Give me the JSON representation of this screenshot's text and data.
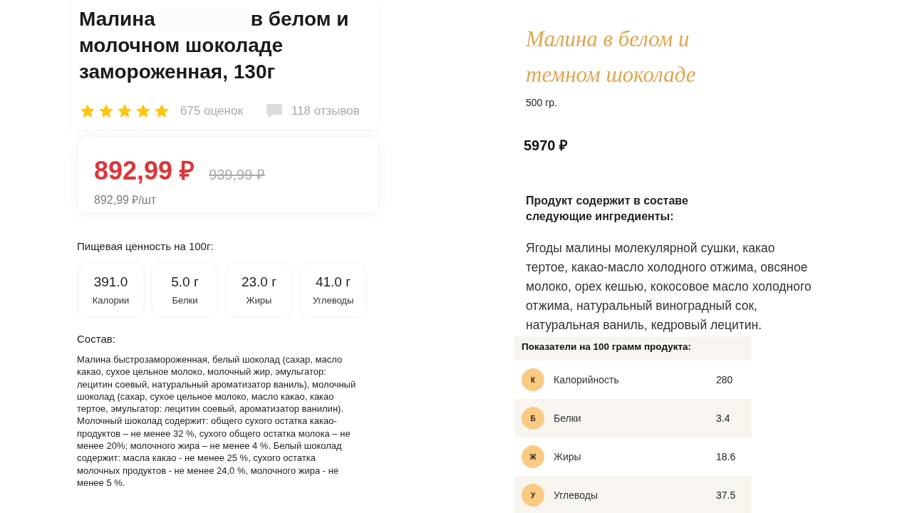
{
  "left": {
    "title_start": "Малина",
    "title_end": "в белом и молочном шоколаде замороженная, 130г",
    "rating": {
      "stars": 5,
      "ratings_count": "675 оценок",
      "reviews_count": "118 отзывов"
    },
    "price": {
      "current": "892,99 ₽",
      "old": "939,99 ₽",
      "per_unit": "892,99 ₽/шт"
    },
    "nutrition_heading": "Пищевая ценность на 100г:",
    "nutrition": [
      {
        "value": "391.0",
        "label": "Калории"
      },
      {
        "value": "5.0 г",
        "label": "Белки"
      },
      {
        "value": "23.0 г",
        "label": "Жиры"
      },
      {
        "value": "41.0 г",
        "label": "Углеводы"
      }
    ],
    "composition_heading": "Состав:",
    "composition": "Малина быстрозамороженная, белый шоколад (сахар, масло какао, сухое цельное молоко, молочный жир, эмульгатор: лецитин соевый, натуральный ароматизатор ваниль), молочный шоколад (сахар, сухое цельное молоко, масло какао, какао тертое, эмульгатор: лецитин соевый, ароматизатор ванилин). Молочный шоколад содержит: общего сухого остатка какао-продуктов – не менее 32 %, сухого общего остатка молока – не менее 20%; молочного жира – не менее 4 %. Белый шоколад содержит: масла какао - не менее 25 %, сухого остатка молочных продуктов - не менее 24,0 %, молочного жира - не менее 5 %."
  },
  "right": {
    "title": "Малина в белом и темном шоколаде",
    "weight": "500 гр.",
    "price": "5970 ₽",
    "ingredients_heading": "Продукт содержит в составе следующие ингредиенты:",
    "ingredients": "Ягоды малины молекулярной сушки, какао тертое, какао-масло холодного отжима, овсяное молоко, орех кешью, кокосовое масло холодного отжима, натуральный виноградный сок, натуральная ваниль, кедровый лецитин.",
    "table_heading": "Показатели на 100 грамм продукта:",
    "table_rows": [
      {
        "letter": "К",
        "name": "Калорийность",
        "value": "280"
      },
      {
        "letter": "Б",
        "name": "Белки",
        "value": "3.4"
      },
      {
        "letter": "Ж",
        "name": "Жиры",
        "value": "18.6"
      },
      {
        "letter": "У",
        "name": "Углеводы",
        "value": "37.5"
      }
    ]
  }
}
